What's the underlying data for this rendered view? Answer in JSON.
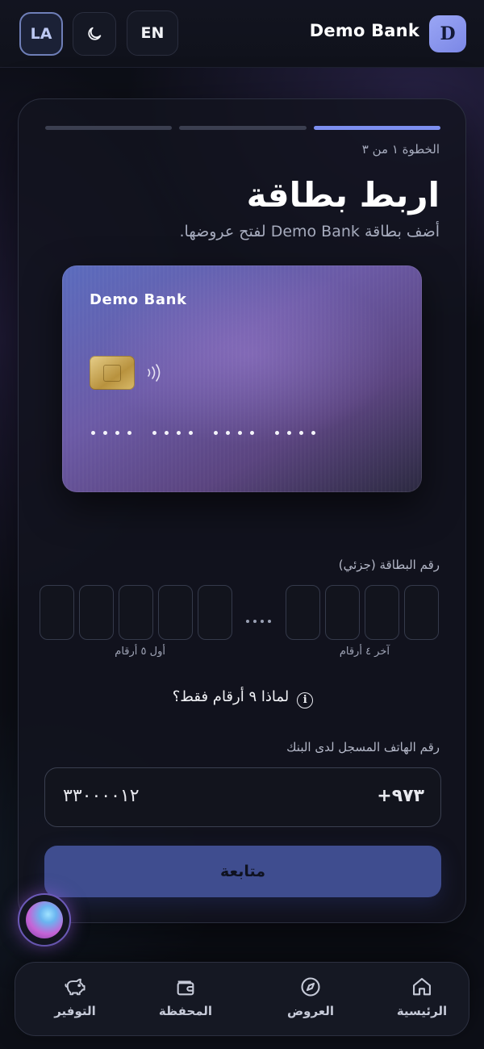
{
  "header": {
    "lang_short": "LA",
    "lang_switch": "EN",
    "brand": "Demo Bank",
    "avatar_letter": "D"
  },
  "onboarding": {
    "step_label": "الخطوة ١ من ٣",
    "title": "اربط بطاقة",
    "subtitle": "أضف بطاقة Demo Bank لفتح عروضها.",
    "card_bank_name": "Demo Bank",
    "card_number_label": "رقم البطاقة (جزئي)",
    "first_digits_hint": "أول ٥ أرقام",
    "last_digits_hint": "آخر ٤ أرقام",
    "why_text": "لماذا ٩ أرقام فقط؟",
    "phone_label": "رقم الهاتف المسجل لدى البنك",
    "phone_code": "+٩٧٣",
    "phone_value": "٣٣٠٠٠٠١٢",
    "continue_label": "متابعة"
  },
  "nav": [
    {
      "label": "الرئيسية",
      "icon": "home-icon"
    },
    {
      "label": "العروض",
      "icon": "compass-icon"
    },
    {
      "label": "المحفظة",
      "icon": "wallet-icon"
    },
    {
      "label": "التوفير",
      "icon": "piggy-bank-icon"
    }
  ],
  "colors": {
    "accent": "#7d8ff0",
    "button": "#3f4d8f",
    "background": "#0d0f17"
  }
}
